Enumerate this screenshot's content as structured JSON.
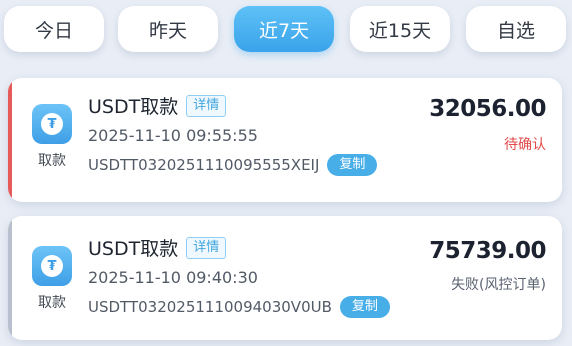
{
  "tabs": [
    {
      "label": "今日",
      "active": false
    },
    {
      "label": "昨天",
      "active": false
    },
    {
      "label": "近7天",
      "active": true
    },
    {
      "label": "近15天",
      "active": false
    },
    {
      "label": "自选",
      "active": false
    }
  ],
  "records": [
    {
      "icon": "usdt-icon",
      "icon_label": "取款",
      "title": "USDT取款",
      "detail_label": "详情",
      "time": "2025-11-10 09:55:55",
      "order_no": "USDTT0320251110095555XEIJ",
      "copy_label": "复制",
      "amount": "32056.00",
      "status": "待确认",
      "status_color": "#e24a4a",
      "bar_color": "#e65a5a"
    },
    {
      "icon": "usdt-icon",
      "icon_label": "取款",
      "title": "USDT取款",
      "detail_label": "详情",
      "time": "2025-11-10 09:40:30",
      "order_no": "USDTT0320251110094030V0UB",
      "copy_label": "复制",
      "amount": "75739.00",
      "status": "失败(风控订单)",
      "status_color": "#5a6170",
      "bar_color": "#b7c0cc"
    }
  ],
  "colors": {
    "accent": "#3aa3ea",
    "background": "#e9eef6"
  }
}
